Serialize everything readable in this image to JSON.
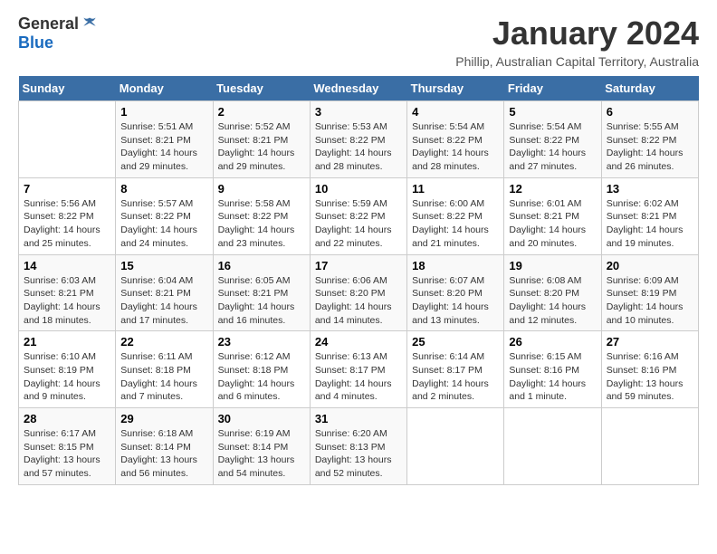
{
  "logo": {
    "general": "General",
    "blue": "Blue"
  },
  "title": "January 2024",
  "subtitle": "Phillip, Australian Capital Territory, Australia",
  "days_of_week": [
    "Sunday",
    "Monday",
    "Tuesday",
    "Wednesday",
    "Thursday",
    "Friday",
    "Saturday"
  ],
  "weeks": [
    [
      {
        "day": "",
        "info": ""
      },
      {
        "day": "1",
        "info": "Sunrise: 5:51 AM\nSunset: 8:21 PM\nDaylight: 14 hours\nand 29 minutes."
      },
      {
        "day": "2",
        "info": "Sunrise: 5:52 AM\nSunset: 8:21 PM\nDaylight: 14 hours\nand 29 minutes."
      },
      {
        "day": "3",
        "info": "Sunrise: 5:53 AM\nSunset: 8:22 PM\nDaylight: 14 hours\nand 28 minutes."
      },
      {
        "day": "4",
        "info": "Sunrise: 5:54 AM\nSunset: 8:22 PM\nDaylight: 14 hours\nand 28 minutes."
      },
      {
        "day": "5",
        "info": "Sunrise: 5:54 AM\nSunset: 8:22 PM\nDaylight: 14 hours\nand 27 minutes."
      },
      {
        "day": "6",
        "info": "Sunrise: 5:55 AM\nSunset: 8:22 PM\nDaylight: 14 hours\nand 26 minutes."
      }
    ],
    [
      {
        "day": "7",
        "info": "Sunrise: 5:56 AM\nSunset: 8:22 PM\nDaylight: 14 hours\nand 25 minutes."
      },
      {
        "day": "8",
        "info": "Sunrise: 5:57 AM\nSunset: 8:22 PM\nDaylight: 14 hours\nand 24 minutes."
      },
      {
        "day": "9",
        "info": "Sunrise: 5:58 AM\nSunset: 8:22 PM\nDaylight: 14 hours\nand 23 minutes."
      },
      {
        "day": "10",
        "info": "Sunrise: 5:59 AM\nSunset: 8:22 PM\nDaylight: 14 hours\nand 22 minutes."
      },
      {
        "day": "11",
        "info": "Sunrise: 6:00 AM\nSunset: 8:22 PM\nDaylight: 14 hours\nand 21 minutes."
      },
      {
        "day": "12",
        "info": "Sunrise: 6:01 AM\nSunset: 8:21 PM\nDaylight: 14 hours\nand 20 minutes."
      },
      {
        "day": "13",
        "info": "Sunrise: 6:02 AM\nSunset: 8:21 PM\nDaylight: 14 hours\nand 19 minutes."
      }
    ],
    [
      {
        "day": "14",
        "info": "Sunrise: 6:03 AM\nSunset: 8:21 PM\nDaylight: 14 hours\nand 18 minutes."
      },
      {
        "day": "15",
        "info": "Sunrise: 6:04 AM\nSunset: 8:21 PM\nDaylight: 14 hours\nand 17 minutes."
      },
      {
        "day": "16",
        "info": "Sunrise: 6:05 AM\nSunset: 8:21 PM\nDaylight: 14 hours\nand 16 minutes."
      },
      {
        "day": "17",
        "info": "Sunrise: 6:06 AM\nSunset: 8:20 PM\nDaylight: 14 hours\nand 14 minutes."
      },
      {
        "day": "18",
        "info": "Sunrise: 6:07 AM\nSunset: 8:20 PM\nDaylight: 14 hours\nand 13 minutes."
      },
      {
        "day": "19",
        "info": "Sunrise: 6:08 AM\nSunset: 8:20 PM\nDaylight: 14 hours\nand 12 minutes."
      },
      {
        "day": "20",
        "info": "Sunrise: 6:09 AM\nSunset: 8:19 PM\nDaylight: 14 hours\nand 10 minutes."
      }
    ],
    [
      {
        "day": "21",
        "info": "Sunrise: 6:10 AM\nSunset: 8:19 PM\nDaylight: 14 hours\nand 9 minutes."
      },
      {
        "day": "22",
        "info": "Sunrise: 6:11 AM\nSunset: 8:18 PM\nDaylight: 14 hours\nand 7 minutes."
      },
      {
        "day": "23",
        "info": "Sunrise: 6:12 AM\nSunset: 8:18 PM\nDaylight: 14 hours\nand 6 minutes."
      },
      {
        "day": "24",
        "info": "Sunrise: 6:13 AM\nSunset: 8:17 PM\nDaylight: 14 hours\nand 4 minutes."
      },
      {
        "day": "25",
        "info": "Sunrise: 6:14 AM\nSunset: 8:17 PM\nDaylight: 14 hours\nand 2 minutes."
      },
      {
        "day": "26",
        "info": "Sunrise: 6:15 AM\nSunset: 8:16 PM\nDaylight: 14 hours\nand 1 minute."
      },
      {
        "day": "27",
        "info": "Sunrise: 6:16 AM\nSunset: 8:16 PM\nDaylight: 13 hours\nand 59 minutes."
      }
    ],
    [
      {
        "day": "28",
        "info": "Sunrise: 6:17 AM\nSunset: 8:15 PM\nDaylight: 13 hours\nand 57 minutes."
      },
      {
        "day": "29",
        "info": "Sunrise: 6:18 AM\nSunset: 8:14 PM\nDaylight: 13 hours\nand 56 minutes."
      },
      {
        "day": "30",
        "info": "Sunrise: 6:19 AM\nSunset: 8:14 PM\nDaylight: 13 hours\nand 54 minutes."
      },
      {
        "day": "31",
        "info": "Sunrise: 6:20 AM\nSunset: 8:13 PM\nDaylight: 13 hours\nand 52 minutes."
      },
      {
        "day": "",
        "info": ""
      },
      {
        "day": "",
        "info": ""
      },
      {
        "day": "",
        "info": ""
      }
    ]
  ]
}
